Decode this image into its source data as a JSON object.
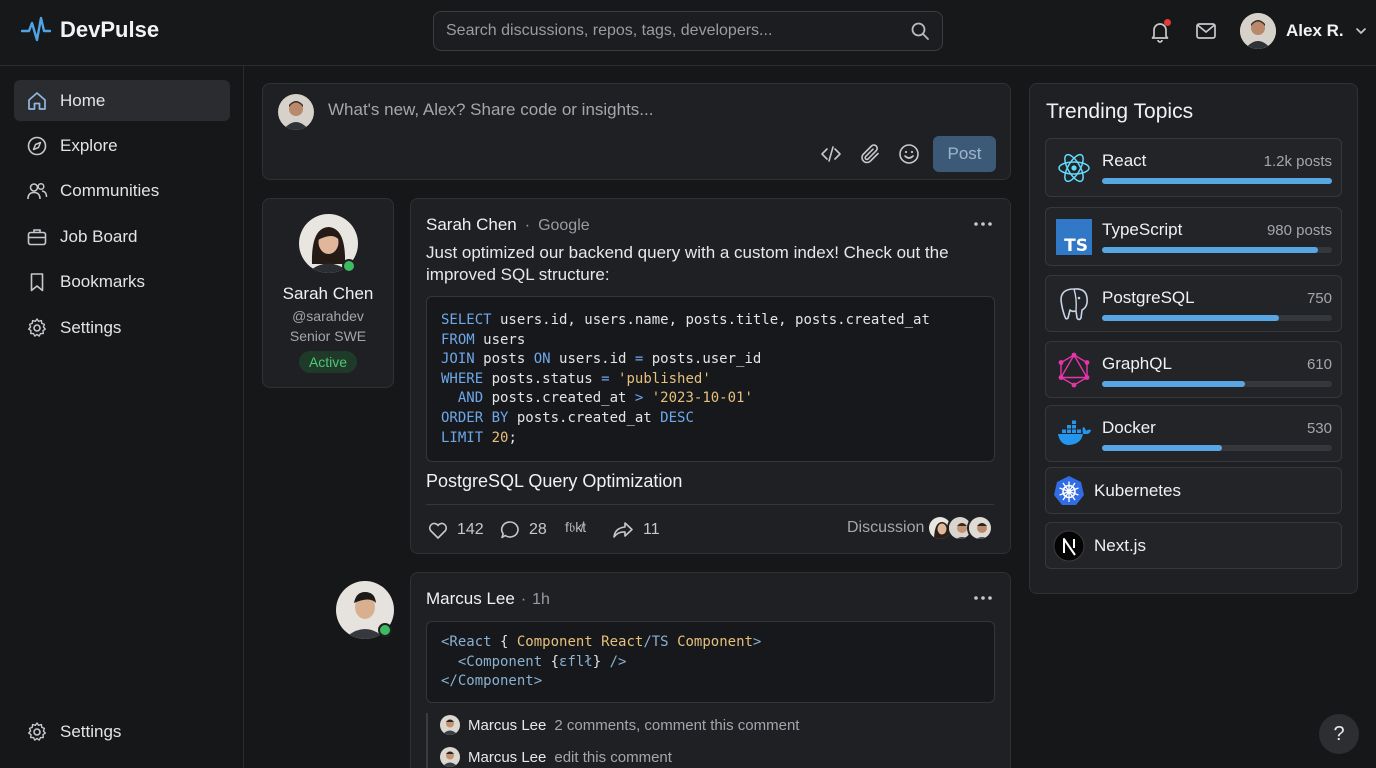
{
  "app": {
    "name": "DevPulse"
  },
  "search": {
    "placeholder": "Search discussions, repos, tags, developers..."
  },
  "header": {
    "user_name": "Alex R.",
    "notification_badge": true
  },
  "sidebar": {
    "items": [
      {
        "label": "Home",
        "icon": "home-icon",
        "active": true
      },
      {
        "label": "Explore",
        "icon": "compass-icon",
        "active": false
      },
      {
        "label": "Communities",
        "icon": "users-icon",
        "active": false
      },
      {
        "label": "Job Board",
        "icon": "briefcase-icon",
        "active": false
      },
      {
        "label": "Bookmarks",
        "icon": "bookmark-icon",
        "active": false
      },
      {
        "label": "Settings",
        "icon": "gear-icon",
        "active": false
      }
    ],
    "bottom_item": {
      "label": "Settings",
      "icon": "gear-icon"
    }
  },
  "composer": {
    "placeholder": "What's new, Alex? Share code or insights...",
    "post_label": "Post"
  },
  "profile_card": {
    "name": "Sarah Chen",
    "handle": "@sarahdev",
    "role": "Senior SWE",
    "status": "Active"
  },
  "posts": [
    {
      "author": "Sarah Chen",
      "separator": "·",
      "company": "Google",
      "text": "Just optimized our backend query with a custom index! Check out the improved SQL structure:",
      "code_lines": [
        [
          [
            "kw",
            "SELECT"
          ],
          [
            "",
            " users.id, users.name, posts.title, posts.created_at"
          ]
        ],
        [
          [
            "kw",
            "FROM"
          ],
          [
            "",
            " users"
          ]
        ],
        [
          [
            "kw",
            "JOIN"
          ],
          [
            "",
            " posts "
          ],
          [
            "kw",
            "ON"
          ],
          [
            "",
            " users.id "
          ],
          [
            "kw",
            "="
          ],
          [
            "",
            " posts.user_id"
          ]
        ],
        [
          [
            "kw",
            "WHERE"
          ],
          [
            "",
            " posts.status "
          ],
          [
            "kw",
            "="
          ],
          [
            "",
            " "
          ],
          [
            "str",
            "'published'"
          ]
        ],
        [
          [
            "",
            "  "
          ],
          [
            "kw",
            "AND"
          ],
          [
            "",
            " posts.created_at "
          ],
          [
            "kw",
            ">"
          ],
          [
            "",
            " "
          ],
          [
            "str",
            "'2023-10-01'"
          ]
        ],
        [
          [
            "kw",
            "ORDER BY"
          ],
          [
            "",
            " posts.created_at "
          ],
          [
            "kw",
            "DESC"
          ]
        ],
        [
          [
            "kw",
            "LIMIT"
          ],
          [
            "",
            " "
          ],
          [
            "str",
            "20"
          ],
          [
            "",
            ";"
          ]
        ]
      ],
      "title": "PostgreSQL Query Optimization",
      "likes": "142",
      "comments": "28",
      "reaction_label": "f𝔟k̸t",
      "shares": "11",
      "category": "Discussion"
    },
    {
      "author": "Marcus Lee",
      "separator": "·",
      "time": "1h",
      "code_lines": [
        [
          [
            "tag",
            "<React"
          ],
          [
            "",
            " { "
          ],
          [
            "comp",
            "Component"
          ],
          [
            "",
            " "
          ],
          [
            "comp",
            "React"
          ],
          [
            "tag",
            "/TS"
          ],
          [
            "",
            " "
          ],
          [
            "comp",
            "Component"
          ],
          [
            "tag",
            ">"
          ]
        ],
        [
          [
            "",
            "  "
          ],
          [
            "tag",
            "<Component"
          ],
          [
            "",
            " {"
          ],
          [
            "tag",
            "ɛflł"
          ],
          [
            "",
            "} "
          ],
          [
            "tag",
            "/>"
          ]
        ],
        [
          [
            "tag",
            "</Component>"
          ]
        ]
      ],
      "comments": [
        {
          "name": "Marcus Lee",
          "text": "2 comments, comment this comment"
        },
        {
          "name": "Marcus Lee",
          "text": "edit this comment"
        }
      ]
    }
  ],
  "trending": {
    "title": "Trending Topics",
    "topics": [
      {
        "name": "React",
        "count": "1.2k posts",
        "share": 1.0,
        "icon": "react-icon"
      },
      {
        "name": "TypeScript",
        "count": "980 posts",
        "share": 0.94,
        "icon": "typescript-icon"
      },
      {
        "name": "PostgreSQL",
        "count": "750",
        "share": 0.77,
        "icon": "postgresql-icon"
      },
      {
        "name": "GraphQL",
        "count": "610",
        "share": 0.62,
        "icon": "graphql-icon"
      },
      {
        "name": "Docker",
        "count": "530",
        "share": 0.52,
        "icon": "docker-icon"
      },
      {
        "name": "Kubernetes",
        "icon": "kubernetes-icon"
      },
      {
        "name": "Next.js",
        "icon": "nextjs-icon"
      }
    ]
  },
  "help": {
    "label": "?"
  }
}
